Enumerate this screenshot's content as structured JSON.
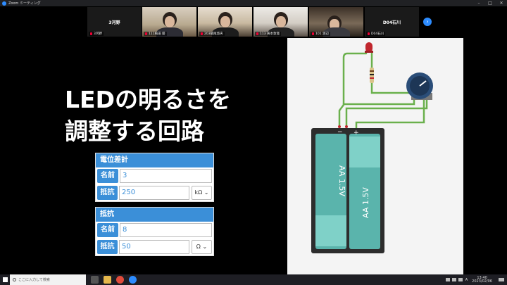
{
  "window": {
    "title": "Zoom ミーティング"
  },
  "participants": [
    {
      "name": "3河野",
      "label": "3河野",
      "video": false
    },
    {
      "name": "",
      "label": "111植田 葵",
      "video": true
    },
    {
      "name": "",
      "label": "203飯尾悠央",
      "video": true
    },
    {
      "name": "",
      "label": "113 黄本敦哉",
      "video": true
    },
    {
      "name": "",
      "label": "101 渡辺",
      "video": true
    },
    {
      "name": "D04石川",
      "label": "D04石川",
      "video": false
    }
  ],
  "slide": {
    "title_line1": "LEDの明るさを",
    "title_line2": "調整する回路"
  },
  "potentiometer_panel": {
    "header": "電位差計",
    "name_label": "名前",
    "name_value": "3",
    "resistance_label": "抵抗",
    "resistance_value": "250",
    "unit": "kΩ"
  },
  "resistor_panel": {
    "header": "抵抗",
    "name_label": "名前",
    "name_value": "8",
    "resistance_label": "抵抗",
    "resistance_value": "50",
    "unit": "Ω"
  },
  "battery": {
    "cell1": "AA 1.5V",
    "cell2": "AA 1.5V",
    "minus": "−",
    "plus": "+"
  },
  "taskbar": {
    "search_placeholder": "ここに入力して検索",
    "time": "13:40",
    "date": "2023/02/06",
    "ime": "A"
  },
  "colors": {
    "panel_blue": "#3b8fd8",
    "wire_green": "#6ab04c",
    "battery_teal": "#5ab4ac",
    "zoom_blue": "#2d8cff"
  }
}
